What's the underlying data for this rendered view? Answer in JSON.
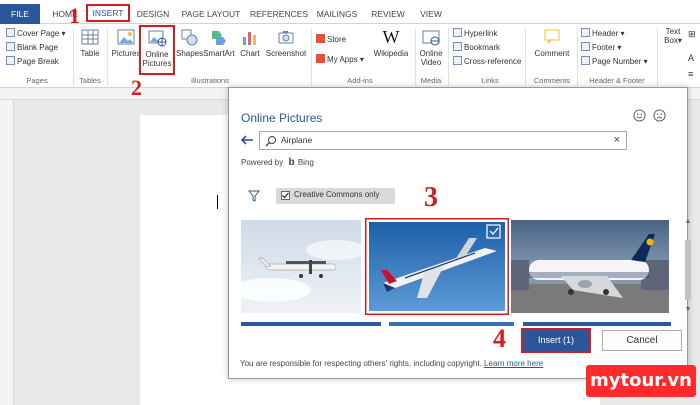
{
  "tabs": [
    {
      "label": "FILE"
    },
    {
      "label": "HOME"
    },
    {
      "label": "INSERT"
    },
    {
      "label": "DESIGN"
    },
    {
      "label": "PAGE LAYOUT"
    },
    {
      "label": "REFERENCES"
    },
    {
      "label": "MAILINGS"
    },
    {
      "label": "REVIEW"
    },
    {
      "label": "VIEW"
    }
  ],
  "ribbon": {
    "pages": {
      "cover": "Cover Page",
      "blank": "Blank Page",
      "break": "Page Break",
      "label": "Pages"
    },
    "tables": {
      "table": "Table",
      "label": "Tables"
    },
    "illustrations": {
      "pictures": "Pictures",
      "online1": "Online",
      "online2": "Pictures",
      "shapes": "Shapes",
      "smartart": "SmartArt",
      "chart": "Chart",
      "screenshot": "Screenshot",
      "label": "Illustrations"
    },
    "addins": {
      "store": "Store",
      "myapps": "My Apps",
      "wikipedia": "Wikipedia",
      "label": "Add-ins"
    },
    "media": {
      "video1": "Online",
      "video2": "Video",
      "label": "Media"
    },
    "links": {
      "hyperlink": "Hyperlink",
      "bookmark": "Bookmark",
      "crossref": "Cross-reference",
      "label": "Links"
    },
    "comments": {
      "comment": "Comment",
      "label": "Comments"
    },
    "headerfooter": {
      "header": "Header",
      "footer": "Footer",
      "pagenumber": "Page Number",
      "label": "Header & Footer"
    },
    "text": {
      "textbox1": "Text",
      "textbox2": "Box"
    }
  },
  "dialog": {
    "title": "Online Pictures",
    "search_value": "Airplane",
    "powered_by": "Powered by",
    "bing": "Bing",
    "creative_commons": "Creative Commons only",
    "insert_button": "Insert (1)",
    "cancel_button": "Cancel",
    "disclaimer": "You are responsible for respecting others' rights, including copyright.",
    "learn_more": "Learn more here"
  },
  "steps": [
    "1",
    "2",
    "3",
    "4"
  ],
  "watermark": "mytour.vn",
  "colors": {
    "accent": "#2b579a",
    "annotation": "#d11f1f",
    "watermark": "#ff2b2b"
  }
}
